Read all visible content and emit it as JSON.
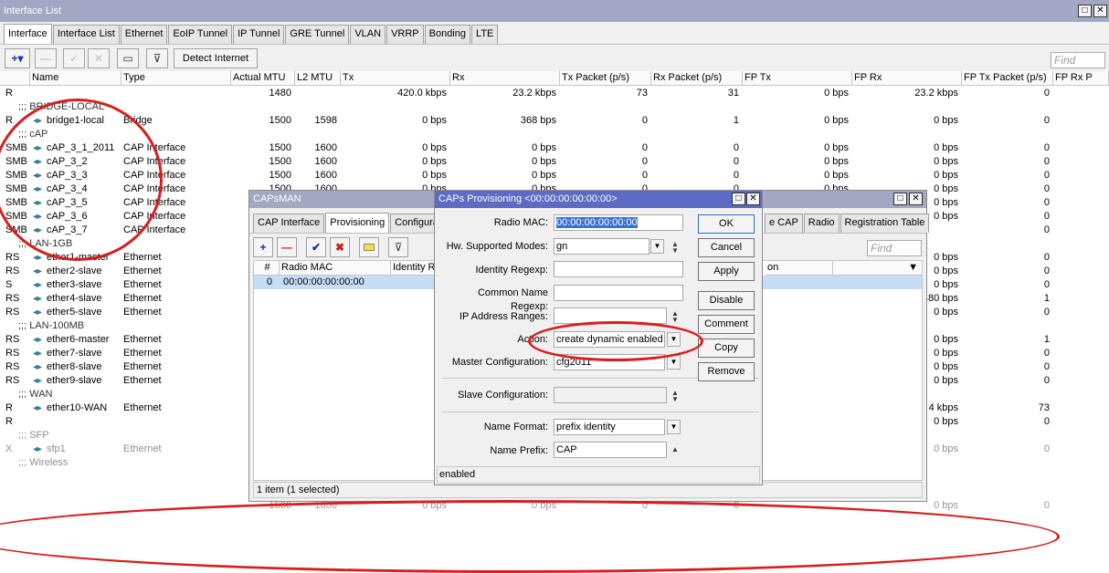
{
  "main": {
    "title": "Interface List",
    "title_buttons": [
      "□",
      "✕"
    ],
    "tabs": [
      "Interface",
      "Interface List",
      "Ethernet",
      "EoIP Tunnel",
      "IP Tunnel",
      "GRE Tunnel",
      "VLAN",
      "VRRP",
      "Bonding",
      "LTE"
    ],
    "toolbar": {
      "add": "+▾",
      "remove": "—",
      "enable": "✓",
      "disable": "✕",
      "comment": "▭",
      "filter": "⊽",
      "detect": "Detect Internet",
      "find_placeholder": "Find"
    },
    "columns": [
      "",
      "Name",
      "Type",
      "Actual MTU",
      "L2 MTU",
      "Tx",
      "Rx",
      "Tx Packet (p/s)",
      "Rx Packet (p/s)",
      "FP Tx",
      "FP Rx",
      "FP Tx Packet (p/s)",
      "FP Rx P"
    ],
    "rows": [
      {
        "kind": "row",
        "flag": "R",
        "name": "",
        "type": "",
        "amtu": "1480",
        "l2mtu": "",
        "tx": "420.0 kbps",
        "rx": "23.2 kbps",
        "txp": "73",
        "rxp": "31",
        "fptx": "0 bps",
        "fprx": "23.2 kbps",
        "fptxp": "0"
      },
      {
        "kind": "sec",
        "text": ";;; BRIDGE-LOCAL"
      },
      {
        "kind": "row",
        "flag": "R",
        "name": "bridge1-local",
        "type": "Bridge",
        "amtu": "1500",
        "l2mtu": "1598",
        "tx": "0 bps",
        "rx": "368 bps",
        "txp": "0",
        "rxp": "1",
        "fptx": "0 bps",
        "fprx": "0 bps",
        "fptxp": "0"
      },
      {
        "kind": "sec",
        "text": ";;; cAP"
      },
      {
        "kind": "row",
        "flag": "SMB",
        "name": "cAP_3_1_2011",
        "type": "CAP Interface",
        "amtu": "1500",
        "l2mtu": "1600",
        "tx": "0 bps",
        "rx": "0 bps",
        "txp": "0",
        "rxp": "0",
        "fptx": "0 bps",
        "fprx": "0 bps",
        "fptxp": "0"
      },
      {
        "kind": "row",
        "flag": "SMB",
        "name": "cAP_3_2",
        "type": "CAP Interface",
        "amtu": "1500",
        "l2mtu": "1600",
        "tx": "0 bps",
        "rx": "0 bps",
        "txp": "0",
        "rxp": "0",
        "fptx": "0 bps",
        "fprx": "0 bps",
        "fptxp": "0"
      },
      {
        "kind": "row",
        "flag": "SMB",
        "name": "cAP_3_3",
        "type": "CAP Interface",
        "amtu": "1500",
        "l2mtu": "1600",
        "tx": "0 bps",
        "rx": "0 bps",
        "txp": "0",
        "rxp": "0",
        "fptx": "0 bps",
        "fprx": "0 bps",
        "fptxp": "0"
      },
      {
        "kind": "row",
        "flag": "SMB",
        "name": "cAP_3_4",
        "type": "CAP Interface",
        "amtu": "1500",
        "l2mtu": "1600",
        "tx": "0 bps",
        "rx": "0 bps",
        "txp": "0",
        "rxp": "0",
        "fptx": "0 bps",
        "fprx": "0 bps",
        "fptxp": "0"
      },
      {
        "kind": "row",
        "flag": "SMB",
        "name": "cAP_3_5",
        "type": "CAP Interface",
        "amtu": "",
        "l2mtu": "",
        "tx": "",
        "rx": "",
        "txp": "",
        "rxp": "",
        "fptx": "0 bps",
        "fprx": "0 bps",
        "fptxp": "0"
      },
      {
        "kind": "row",
        "flag": "SMB",
        "name": "cAP_3_6",
        "type": "CAP Interface",
        "amtu": "",
        "l2mtu": "",
        "tx": "",
        "rx": "",
        "txp": "",
        "rxp": "",
        "fptx": "",
        "fprx": "0 bps",
        "fptxp": "0"
      },
      {
        "kind": "row",
        "flag": "SMB",
        "name": "cAP_3_7",
        "type": "CAP Interface",
        "amtu": "",
        "l2mtu": "",
        "tx": "",
        "rx": "",
        "txp": "",
        "rxp": "",
        "fptx": "",
        "fprx": "",
        "fptxp": "0"
      },
      {
        "kind": "sec",
        "text": ";;; LAN-1GB"
      },
      {
        "kind": "row",
        "flag": "RS",
        "name": "ether1-master",
        "type": "Ethernet",
        "amtu": "",
        "l2mtu": "",
        "tx": "",
        "rx": "",
        "txp": "",
        "rxp": "",
        "fptx": "",
        "fprx": "0 bps",
        "fptxp": "0"
      },
      {
        "kind": "row",
        "flag": "RS",
        "name": "ether2-slave",
        "type": "Ethernet",
        "amtu": "",
        "l2mtu": "",
        "tx": "",
        "rx": "",
        "txp": "",
        "rxp": "",
        "fptx": "",
        "fprx": "0 bps",
        "fptxp": "0"
      },
      {
        "kind": "row",
        "flag": "S",
        "name": "ether3-slave",
        "type": "Ethernet",
        "amtu": "",
        "l2mtu": "",
        "tx": "",
        "rx": "",
        "txp": "",
        "rxp": "",
        "fptx": "",
        "fprx": "0 bps",
        "fptxp": "0"
      },
      {
        "kind": "row",
        "flag": "RS",
        "name": "ether4-slave",
        "type": "Ethernet",
        "amtu": "",
        "l2mtu": "",
        "tx": "",
        "rx": "",
        "txp": "",
        "rxp": "",
        "fptx": "",
        "fprx": "480 bps",
        "fptxp": "1"
      },
      {
        "kind": "row",
        "flag": "RS",
        "name": "ether5-slave",
        "type": "Ethernet",
        "amtu": "",
        "l2mtu": "",
        "tx": "",
        "rx": "",
        "txp": "",
        "rxp": "",
        "fptx": "",
        "fprx": "0 bps",
        "fptxp": "0"
      },
      {
        "kind": "sec",
        "text": ";;; LAN-100MB"
      },
      {
        "kind": "row",
        "flag": "RS",
        "name": "ether6-master",
        "type": "Ethernet",
        "amtu": "",
        "l2mtu": "",
        "tx": "",
        "rx": "",
        "txp": "",
        "rxp": "",
        "fptx": "",
        "fprx": "0 bps",
        "fptxp": "1"
      },
      {
        "kind": "row",
        "flag": "RS",
        "name": "ether7-slave",
        "type": "Ethernet",
        "amtu": "",
        "l2mtu": "",
        "tx": "",
        "rx": "",
        "txp": "",
        "rxp": "",
        "fptx": "",
        "fprx": "0 bps",
        "fptxp": "0"
      },
      {
        "kind": "row",
        "flag": "RS",
        "name": "ether8-slave",
        "type": "Ethernet",
        "amtu": "",
        "l2mtu": "",
        "tx": "",
        "rx": "",
        "txp": "",
        "rxp": "",
        "fptx": "",
        "fprx": "0 bps",
        "fptxp": "0"
      },
      {
        "kind": "row",
        "flag": "RS",
        "name": "ether9-slave",
        "type": "Ethernet",
        "amtu": "",
        "l2mtu": "",
        "tx": "",
        "rx": "",
        "txp": "",
        "rxp": "",
        "fptx": "",
        "fprx": "0 bps",
        "fptxp": "0"
      },
      {
        "kind": "sec",
        "text": ";;; WAN"
      },
      {
        "kind": "row",
        "flag": "R",
        "name": "ether10-WAN",
        "type": "Ethernet",
        "amtu": "",
        "l2mtu": "",
        "tx": "",
        "rx": "",
        "txp": "",
        "rxp": "",
        "fptx": "",
        "fprx": "4 kbps",
        "fptxp": "73"
      },
      {
        "kind": "row",
        "flag": "R",
        "name": "",
        "type": "",
        "amtu": "",
        "l2mtu": "",
        "tx": "",
        "rx": "",
        "txp": "",
        "rxp": "",
        "fptx": "",
        "fprx": "0 bps",
        "fptxp": "0"
      },
      {
        "kind": "secdis",
        "text": ";;; SFP"
      },
      {
        "kind": "rowdis",
        "flag": "X",
        "name": "sfp1",
        "type": "Ethernet",
        "amtu": "",
        "l2mtu": "",
        "tx": "",
        "rx": "",
        "txp": "",
        "rxp": "",
        "fptx": "",
        "fprx": "0 bps",
        "fptxp": "0"
      },
      {
        "kind": "secdis",
        "text": ";;; Wireless"
      }
    ],
    "partial_bottom": {
      "amtu": "1500",
      "l2mtu": "1600",
      "tx": "0 bps",
      "rx": "0 bps",
      "txp": "0",
      "rxp": "0",
      "fprx": "0 bps",
      "fptxp": "0"
    }
  },
  "capsman": {
    "title": "CAPsMAN",
    "tabs": [
      "CAP Interface",
      "Provisioning",
      "Configurat"
    ],
    "right_tabs": [
      "e CAP",
      "Radio",
      "Registration Table"
    ],
    "find_placeholder": "Find",
    "columns": [
      "#",
      "Radio MAC",
      "Identity R"
    ],
    "right_col": "on",
    "row": {
      "num": "0",
      "mac": "00:00:00:00:00:00"
    },
    "status": "1 item (1 selected)"
  },
  "dialog": {
    "title": "CAPs Provisioning <00:00:00:00:00:00>",
    "fields": {
      "radio_mac": {
        "label": "Radio MAC:",
        "value": "00:00:00:00:00:00"
      },
      "hw_modes": {
        "label": "Hw. Supported Modes:",
        "value": "gn"
      },
      "identity_regexp": {
        "label": "Identity Regexp:",
        "value": ""
      },
      "common_name_regexp": {
        "label": "Common Name Regexp:",
        "value": ""
      },
      "ip_ranges": {
        "label": "IP Address Ranges:",
        "value": ""
      },
      "action": {
        "label": "Action:",
        "value": "create dynamic enabled"
      },
      "master_config": {
        "label": "Master Configuration:",
        "value": "cfg2011"
      },
      "slave_config": {
        "label": "Slave Configuration:",
        "value": ""
      },
      "name_format": {
        "label": "Name Format:",
        "value": "prefix identity"
      },
      "name_prefix": {
        "label": "Name Prefix:",
        "value": "CAP"
      }
    },
    "buttons": [
      "OK",
      "Cancel",
      "Apply",
      "Disable",
      "Comment",
      "Copy",
      "Remove"
    ],
    "status": "enabled"
  },
  "colors": {
    "title_active": "#5e6bc4",
    "title_inactive": "#a3a7c3",
    "highlight": "#d81e1e",
    "selection": "#c7dcf5"
  }
}
